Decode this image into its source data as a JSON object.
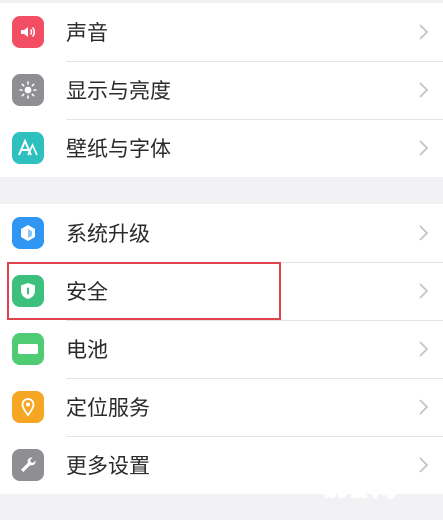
{
  "group1": [
    {
      "name": "sound",
      "label": "声音",
      "icon": "speaker-icon",
      "color": "#f24d63"
    },
    {
      "name": "display",
      "label": "显示与亮度",
      "icon": "sun-icon",
      "color": "#8e8e93"
    },
    {
      "name": "wallpaper",
      "label": "壁纸与字体",
      "icon": "font-icon",
      "color": "#2ebfbf"
    }
  ],
  "group2": [
    {
      "name": "system-update",
      "label": "系统升级",
      "icon": "update-icon",
      "color": "#2f96f3"
    },
    {
      "name": "security",
      "label": "安全",
      "icon": "shield-icon",
      "color": "#3dbf7e"
    },
    {
      "name": "battery",
      "label": "电池",
      "icon": "battery-icon",
      "color": "#4ecb73"
    },
    {
      "name": "location",
      "label": "定位服务",
      "icon": "location-pin-icon",
      "color": "#f5a623"
    },
    {
      "name": "more-settings",
      "label": "更多设置",
      "icon": "wrench-icon",
      "color": "#8e8e93"
    }
  ],
  "highlight_color": "#e0434b",
  "watermark": "锐客网"
}
